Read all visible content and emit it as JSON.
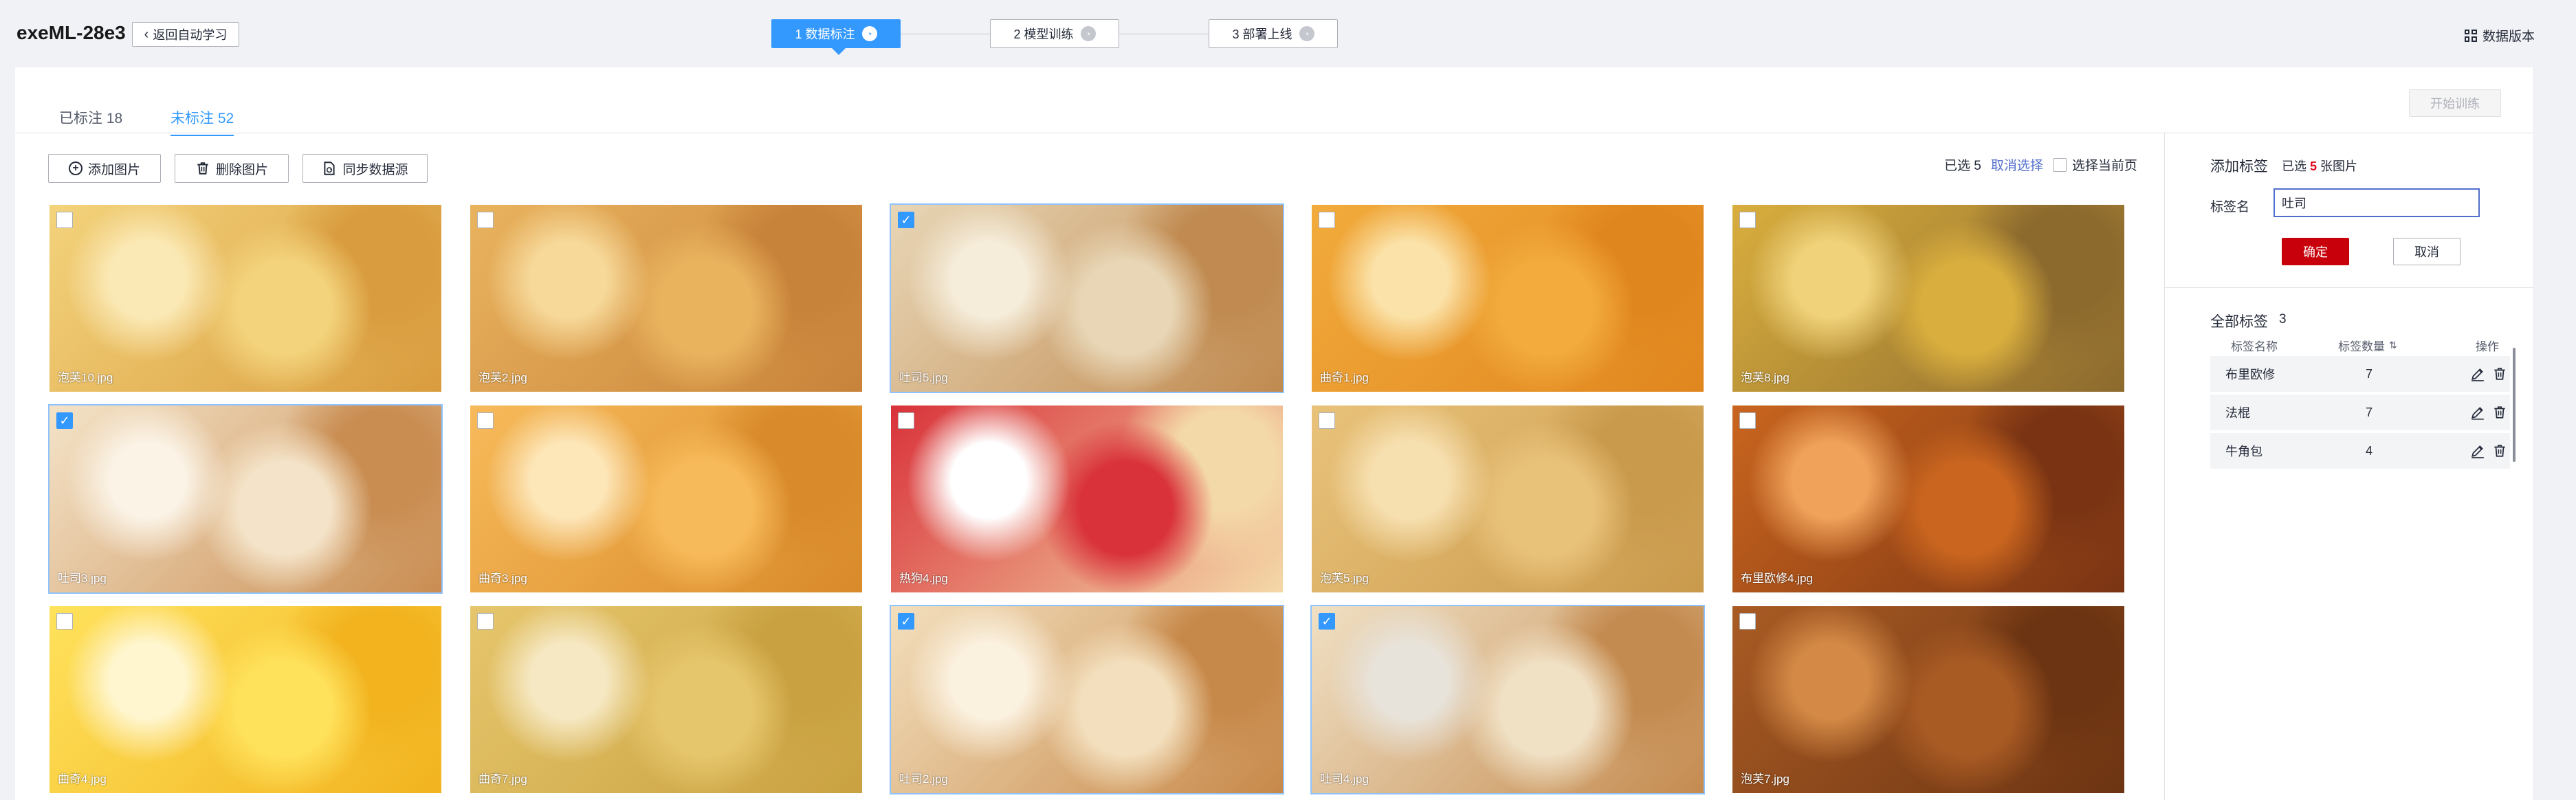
{
  "app": {
    "title": "exeML-28e3",
    "back_label": "返回自动学习",
    "data_version_label": "数据版本"
  },
  "steps": [
    {
      "label": "1 数据标注",
      "state": "active"
    },
    {
      "label": "2 模型训练",
      "state": "pending"
    },
    {
      "label": "3 部署上线",
      "state": "pending"
    }
  ],
  "tabs": {
    "labeled": "已标注 18",
    "unlabeled": "未标注 52",
    "active": "unlabeled"
  },
  "toolbar": {
    "start_training": "开始训练",
    "add_image": "添加图片",
    "delete_image": "删除图片",
    "sync_source": "同步数据源",
    "selected_text": "已选 5",
    "cancel_select": "取消选择",
    "select_page": "选择当前页"
  },
  "images": [
    {
      "name": "泡芙10.jpg",
      "selected": false,
      "palette": [
        "#f3d37c",
        "#d99c3e",
        "#fbe9b5"
      ]
    },
    {
      "name": "泡芙2.jpg",
      "selected": false,
      "palette": [
        "#e9b35e",
        "#c8833a",
        "#f7d99a"
      ]
    },
    {
      "name": "吐司5.jpg",
      "selected": true,
      "palette": [
        "#e8d6b6",
        "#c08a50",
        "#f5ecd9"
      ]
    },
    {
      "name": "曲奇1.jpg",
      "selected": false,
      "palette": [
        "#f2ab3c",
        "#e0861e",
        "#fbe2a8"
      ]
    },
    {
      "name": "泡芙8.jpg",
      "selected": false,
      "palette": [
        "#d9ae3e",
        "#8c6a2e",
        "#f0d27a"
      ]
    },
    {
      "name": "吐司3.jpg",
      "selected": true,
      "palette": [
        "#f4e3c8",
        "#c98d52",
        "#fbf3e6"
      ]
    },
    {
      "name": "曲奇3.jpg",
      "selected": false,
      "palette": [
        "#f7ba5a",
        "#d98a2a",
        "#fde6b8"
      ]
    },
    {
      "name": "热狗4.jpg",
      "selected": false,
      "palette": [
        "#d9323a",
        "#f4d9a8",
        "#ffffff"
      ]
    },
    {
      "name": "泡芙5.jpg",
      "selected": false,
      "palette": [
        "#e9c27a",
        "#c99a4c",
        "#f7e0b0"
      ]
    },
    {
      "name": "布里欧修4.jpg",
      "selected": false,
      "palette": [
        "#c9651f",
        "#7a3413",
        "#f0a25a"
      ]
    },
    {
      "name": "曲奇4.jpg",
      "selected": false,
      "palette": [
        "#ffe25c",
        "#f2b31f",
        "#fff6cf"
      ]
    },
    {
      "name": "曲奇7.jpg",
      "selected": false,
      "palette": [
        "#e6c66c",
        "#c9a141",
        "#f6e8c2"
      ]
    },
    {
      "name": "吐司2.jpg",
      "selected": true,
      "palette": [
        "#f3dfbd",
        "#c7894a",
        "#fbf1df"
      ]
    },
    {
      "name": "吐司4.jpg",
      "selected": true,
      "palette": [
        "#f0e0c4",
        "#c48b50",
        "#e8e3da"
      ]
    },
    {
      "name": "泡芙7.jpg",
      "selected": false,
      "palette": [
        "#a95b24",
        "#6c3412",
        "#d48a46"
      ]
    }
  ],
  "label_panel": {
    "title": "添加标签",
    "selected_prefix": "已选",
    "selected_count": "5",
    "selected_suffix": "张图片",
    "field_label": "标签名",
    "field_value": "吐司",
    "confirm": "确定",
    "cancel": "取消",
    "all_labels_title": "全部标签",
    "all_labels_count": "3",
    "columns": {
      "name": "标签名称",
      "count": "标签数量",
      "actions": "操作"
    },
    "rows": [
      {
        "name": "布里欧修",
        "count": "7"
      },
      {
        "name": "法棍",
        "count": "7"
      },
      {
        "name": "牛角包",
        "count": "4"
      }
    ]
  },
  "colors": {
    "primary": "#3399ff",
    "danger": "#c7000b",
    "link": "#526ecc"
  }
}
